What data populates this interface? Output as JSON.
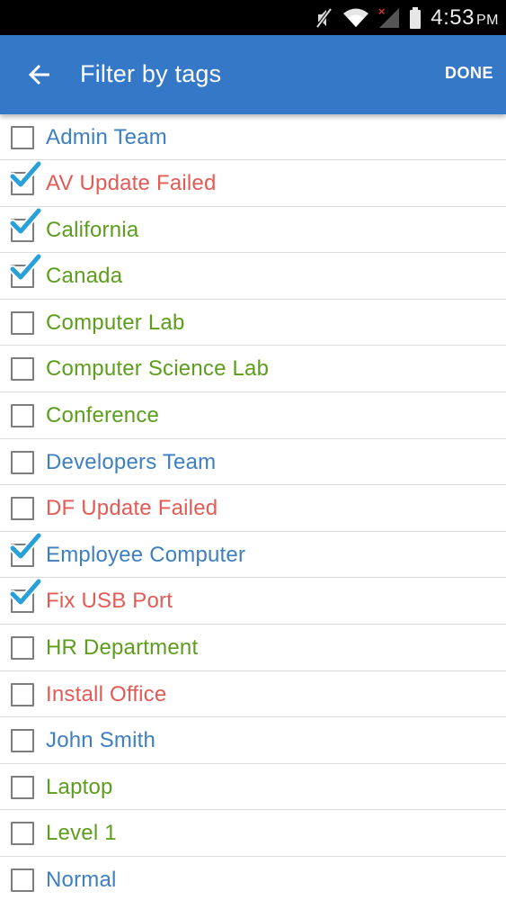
{
  "status_bar": {
    "time": "4:53",
    "ampm": "PM",
    "icons": [
      "mute-icon",
      "wifi-icon",
      "cell-signal-no-service-icon",
      "battery-icon"
    ]
  },
  "app_bar": {
    "title": "Filter by tags",
    "back_icon": "arrow-back-icon",
    "done_label": "DONE",
    "background_color": "#3478c7"
  },
  "colors": {
    "blue": "#3d7fc1",
    "red": "#e25b55",
    "green": "#5d9d1e",
    "check": "#2aa0d8"
  },
  "tags": [
    {
      "label": "Admin Team",
      "checked": false,
      "color": "blue"
    },
    {
      "label": "AV Update Failed",
      "checked": true,
      "color": "red"
    },
    {
      "label": "California",
      "checked": true,
      "color": "green"
    },
    {
      "label": "Canada",
      "checked": true,
      "color": "green"
    },
    {
      "label": "Computer Lab",
      "checked": false,
      "color": "green"
    },
    {
      "label": "Computer Science Lab",
      "checked": false,
      "color": "green"
    },
    {
      "label": "Conference",
      "checked": false,
      "color": "green"
    },
    {
      "label": "Developers Team",
      "checked": false,
      "color": "blue"
    },
    {
      "label": "DF Update Failed",
      "checked": false,
      "color": "red"
    },
    {
      "label": "Employee Computer",
      "checked": true,
      "color": "blue"
    },
    {
      "label": "Fix USB Port",
      "checked": true,
      "color": "red"
    },
    {
      "label": "HR Department",
      "checked": false,
      "color": "green"
    },
    {
      "label": "Install Office",
      "checked": false,
      "color": "red"
    },
    {
      "label": "John Smith",
      "checked": false,
      "color": "blue"
    },
    {
      "label": "Laptop",
      "checked": false,
      "color": "green"
    },
    {
      "label": "Level 1",
      "checked": false,
      "color": "green"
    },
    {
      "label": "Normal",
      "checked": false,
      "color": "blue"
    }
  ]
}
